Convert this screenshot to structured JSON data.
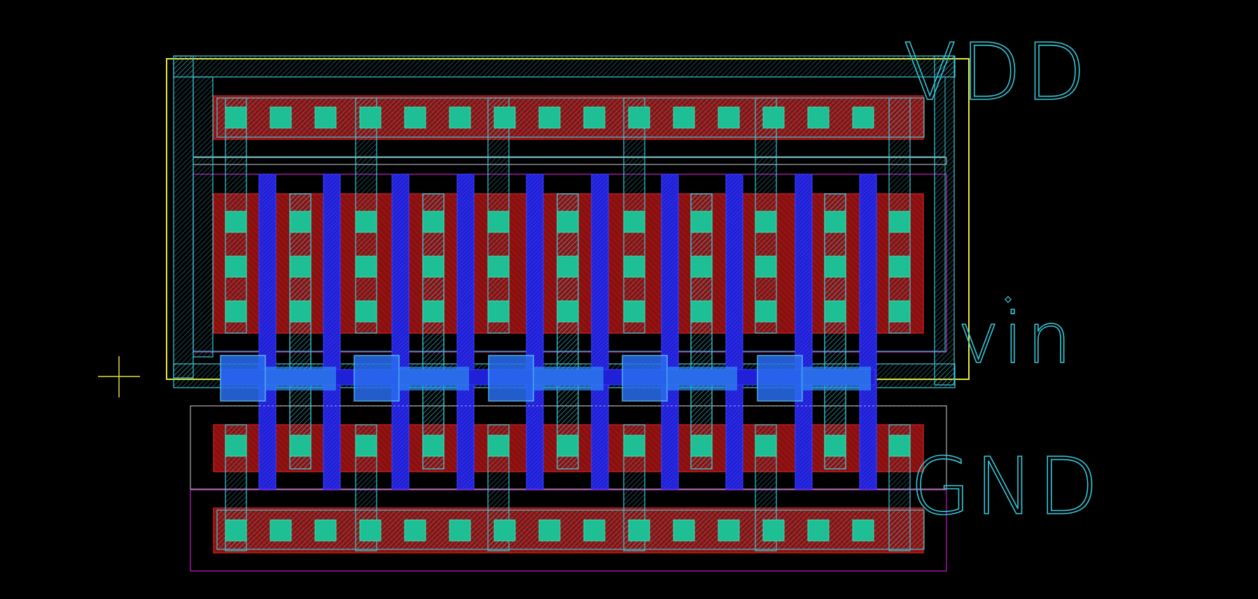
{
  "pin_labels": {
    "vdd": "VDD",
    "vin": "vin",
    "gnd": "GND"
  },
  "colors": {
    "background": "#000000",
    "nwell": "#e8e83a",
    "active": "#b01515",
    "metal1": "#3fc8d6",
    "contact": "#1fbf95",
    "poly": "#2020d8",
    "poly_contact": "#2a6ef0",
    "select_outline": "#c020c0",
    "outline": "#d0d0d0",
    "origin_marker": "#e0e030",
    "label": "#33c8d8"
  },
  "layers": [
    "nwell",
    "active",
    "metal1",
    "contact",
    "poly",
    "poly_contact",
    "select"
  ]
}
